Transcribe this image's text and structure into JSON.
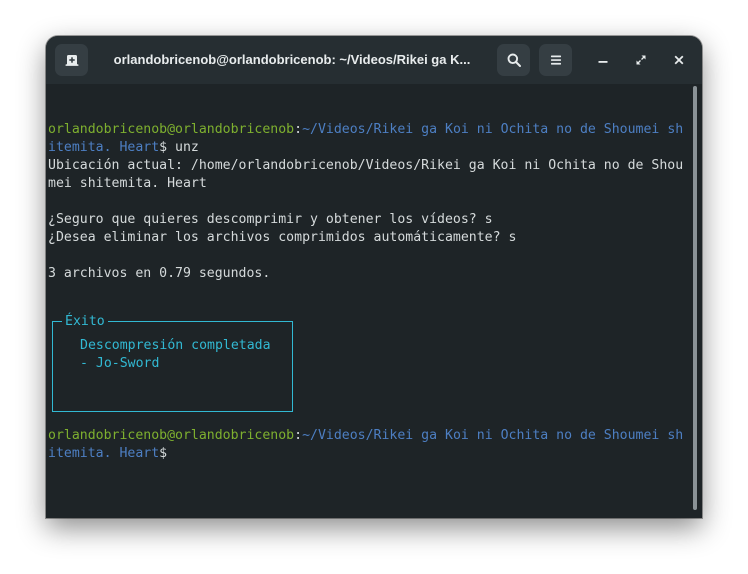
{
  "window": {
    "title": "orlandobricenob@orlandobricenob: ~/Videos/Rikei ga K..."
  },
  "icons": {
    "new_tab": "new-tab-icon",
    "search": "search-icon",
    "menu": "hamburger-menu-icon",
    "minimize": "minimize-icon",
    "maximize": "maximize-icon",
    "close": "close-icon"
  },
  "colors": {
    "background": "#1e2427",
    "headerbar": "#262e32",
    "prompt_user": "#7eb02f",
    "prompt_path": "#4d7fc3",
    "text": "#d5dadb",
    "accent_cyan": "#32b9d3"
  },
  "terminal": {
    "prompt1": {
      "user": "orlandobricenob@orlandobricenob",
      "colon": ":",
      "path_part1": "~/Videos/Rikei ga Koi ni Ochita no de Shoumei sh",
      "path_part2": "itemita. Heart",
      "symbol": "$",
      "command": " unz"
    },
    "location_line1": "Ubicación actual: /home/orlandobricenob/Videos/Rikei ga Koi ni Ochita no de Shou",
    "location_line2": "mei shitemita. Heart",
    "question1": "¿Seguro que quieres descomprimir y obtener los vídeos? s",
    "question2": "¿Desea eliminar los archivos comprimidos automáticamente? s",
    "summary": "3 archivos en 0.79 segundos.",
    "box": {
      "legend": "Éxito",
      "line1": "Descompresión completada",
      "line2": "- Jo-Sword"
    },
    "prompt2": {
      "user": "orlandobricenob@orlandobricenob",
      "colon": ":",
      "path_part1": "~/Videos/Rikei ga Koi ni Ochita no de Shoumei sh",
      "path_part2": "itemita. Heart",
      "symbol": "$"
    }
  }
}
